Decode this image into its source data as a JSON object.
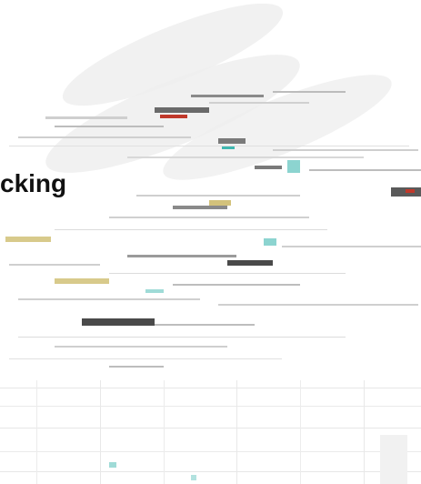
{
  "page": {
    "heading": "cking"
  },
  "colors": {
    "background": "#ffffff",
    "leaf": "#efefef",
    "streak_light": "#d9d9d9",
    "streak_mid": "#9a9a9a",
    "streak_dark": "#4a4a4a",
    "accent_red": "#c0392b",
    "accent_teal": "#3fb7b0",
    "accent_olive": "#c8b35a",
    "heading_text": "#111111"
  }
}
